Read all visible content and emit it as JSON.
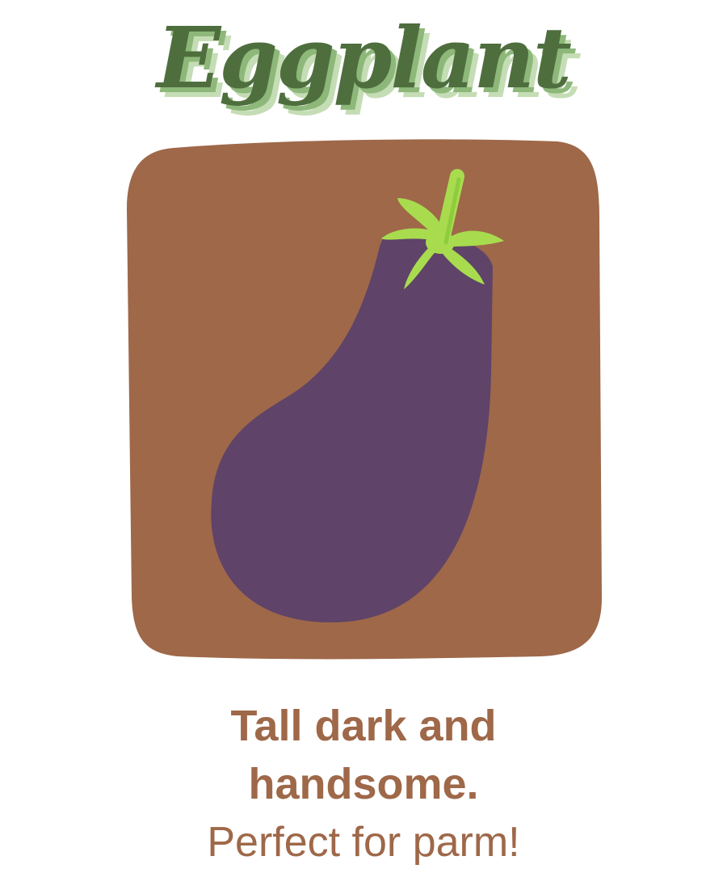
{
  "title": "Eggplant",
  "tagline": "Tall dark and handsome.",
  "subtitle": "Perfect for parm!",
  "colors": {
    "background_tile": "#9e6849",
    "eggplant": "#5f4368",
    "leaves": "#a8dc4e",
    "title": "#4f6e3e",
    "text": "#9e6849"
  }
}
